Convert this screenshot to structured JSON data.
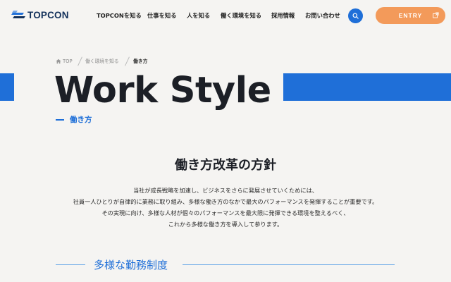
{
  "header": {
    "logo_text": "TOPCON",
    "nav": [
      {
        "label": "TOPCONを知る"
      },
      {
        "label": "仕事を知る"
      },
      {
        "label": "人を知る"
      },
      {
        "label": "働く環境を知る"
      },
      {
        "label": "採用情報"
      },
      {
        "label": "お問い合わせ"
      }
    ],
    "search_icon": "search-icon",
    "entry_label": "ENTRY",
    "entry_icon": "external-link-icon"
  },
  "breadcrumb": {
    "home_icon": "home-icon",
    "items": [
      "TOP",
      "働く環境を知る",
      "働き方"
    ]
  },
  "hero": {
    "title": "Work Style",
    "subtitle": "働き方"
  },
  "policy": {
    "title": "働き方改革の方針",
    "lines": [
      "当社が成長戦略を加速し、ビジネスをさらに発展させていくためには、",
      "社員一人ひとりが自律的に業務に取り組み、多様な働き方のなかで最大のパフォーマンスを発揮することが重要です。",
      "その実現に向け、多様な人材が個々のパフォーマンスを最大限に発揮できる環境を整えるべく、",
      "これから多様な働き方を導入して参ります。"
    ]
  },
  "section": {
    "title": "多様な勤務制度"
  },
  "colors": {
    "accent_blue": "#1f6fd8",
    "entry_orange": "#f39a5a",
    "background": "#f5f4f2",
    "logo_navy": "#12305a"
  }
}
